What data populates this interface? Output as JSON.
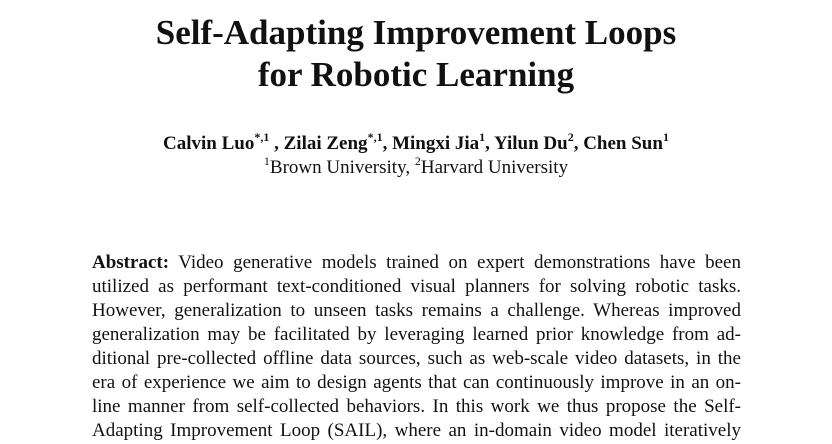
{
  "paper": {
    "title_lines": [
      "Self-Adapting Improvement Loops",
      "for Robotic Learning"
    ],
    "authors": [
      {
        "name": "Calvin Luo",
        "sup": "*,1",
        "sep": " , "
      },
      {
        "name": "Zilai Zeng",
        "sup": "*,1",
        "sep": ", "
      },
      {
        "name": "Mingxi Jia",
        "sup": "1",
        "sep": ", "
      },
      {
        "name": "Yilun Du",
        "sup": "2",
        "sep": ", "
      },
      {
        "name": "Chen Sun",
        "sup": "1",
        "sep": ""
      }
    ],
    "affiliations": [
      {
        "sup": "1",
        "name": "Brown University",
        "sep": ", "
      },
      {
        "sup": "2",
        "name": "Harvard University",
        "sep": ""
      }
    ],
    "abstract": {
      "heading": "Abstract:",
      "lines": [
        " Video generative models trained on expert demonstrations have been",
        "utilized as performant text-conditioned visual planners for solving robotic tasks.",
        "However, generalization to unseen tasks remains a challenge. Whereas improved",
        "generalization may be facilitated by leveraging learned prior knowledge from ad-",
        "ditional pre-collected offline data sources, such as web-scale video datasets, in the",
        "era of experience we aim to design agents that can continuously improve in an on-",
        "line manner from self-collected behaviors. In this work we thus propose the Self-",
        "Adapting Improvement Loop (SAIL), where an in-domain video model iteratively"
      ]
    }
  }
}
